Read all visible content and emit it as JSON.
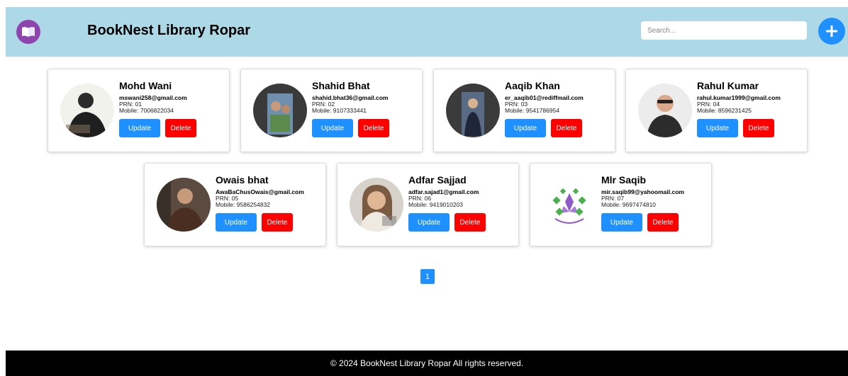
{
  "header": {
    "title": "BookNest Library Ropar",
    "logo_icon": "book-icon",
    "search_placeholder": "Search...",
    "add_icon": "plus-icon",
    "bg_color": "#add8e6"
  },
  "members": [
    {
      "name": "Mohd Wani",
      "email": "mswani258@gmail.com",
      "prn": "PRN: 01",
      "mobile": "Mobile: 7006822034"
    },
    {
      "name": "Shahid Bhat",
      "email": "shahid.bhat36@gmail.com",
      "prn": "PRN: 02",
      "mobile": "Mobile: 9107333441"
    },
    {
      "name": "Aaqib Khan",
      "email": "er_aaqib01@rediffmail.com",
      "prn": "PRN: 03",
      "mobile": "Mobile: 9541786954"
    },
    {
      "name": "Rahul Kumar",
      "email": "rahul.kumar1999@gmail.com",
      "prn": "PRN: 04",
      "mobile": "Mobile: 8596231425"
    },
    {
      "name": "Owais bhat",
      "email": "AwaBaChusOwais@gmail.com",
      "prn": "PRN: 05",
      "mobile": "Mobile: 9586254832"
    },
    {
      "name": "Adfar Sajjad",
      "email": "adfar.sajad1@gmail.com",
      "prn": "PRN: 06",
      "mobile": "Mobile: 9419010203"
    },
    {
      "name": "Mlr Saqib",
      "email": "mir.saqib99@yahoomail.com",
      "prn": "PRN: 07",
      "mobile": "Mobile: 9697474810"
    }
  ],
  "buttons": {
    "update": "Update",
    "delete": "Delete"
  },
  "pagination": {
    "current": "1"
  },
  "footer": {
    "text": "© 2024 BookNest Library Ropar All rights reserved."
  },
  "colors": {
    "primary": "#1e90ff",
    "danger": "#ff0000",
    "footer_bg": "#000000"
  }
}
